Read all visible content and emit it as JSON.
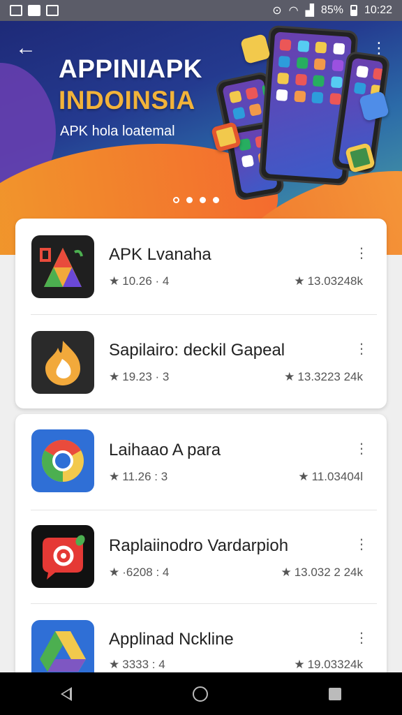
{
  "status_bar": {
    "battery": "85%",
    "time": "10:22"
  },
  "banner": {
    "title_line1": "APPINIAPK",
    "title_line2": "INDOINSIA",
    "subtitle": "APK hola loatemal",
    "carousel_pages": 4,
    "carousel_active": 1
  },
  "apps": [
    {
      "name": "APK Lvanaha",
      "rating": "10.26 · 4",
      "downloads": "13.03248k",
      "icon": "apk-a-icon"
    },
    {
      "name": "Sapilairo: deckil Gapeal",
      "rating": "19.23 · 3",
      "downloads": "13.3223 24k",
      "icon": "fire-icon"
    },
    {
      "name": "Laihaao A para",
      "rating": "11.26 : 3",
      "downloads": "11.03404l",
      "icon": "chrome-icon"
    },
    {
      "name": "Raplaiinodro Vardarpioh",
      "rating": "·6208 : 4",
      "downloads": "13.032 2 24k",
      "icon": "rocket-icon"
    },
    {
      "name": "Applinad Nckline",
      "rating": "3333 : 4",
      "downloads": "19.03324k",
      "icon": "drive-icon"
    }
  ],
  "colors": {
    "accent": "#f0772e",
    "title_yellow": "#f2b33a"
  }
}
